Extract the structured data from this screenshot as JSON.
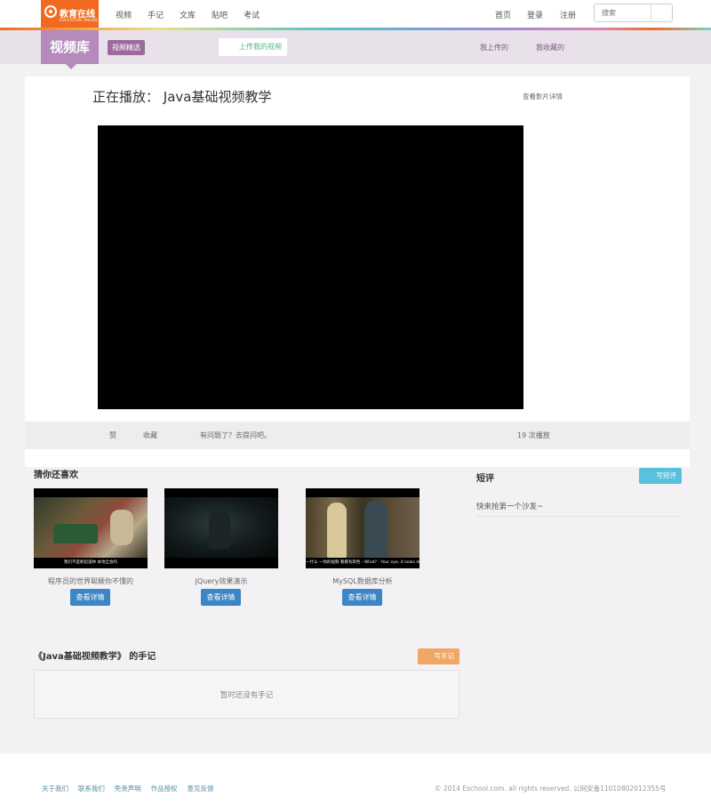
{
  "brand": {
    "name": "教育在线",
    "tagline": "EDUCATION ONLINE"
  },
  "topnav": {
    "left_items": [
      "视频",
      "手记",
      "文库",
      "贴吧",
      "考试"
    ],
    "right_items": [
      "首页",
      "登录",
      "注册"
    ],
    "search_placeholder": "搜索"
  },
  "subheader": {
    "library_label": "视频库",
    "featured_label": "视频精选",
    "upload_label": "上传我的视频",
    "my_uploads_label": "我上传的",
    "my_favorites_label": "我收藏的"
  },
  "player": {
    "now_playing_prefix": "正在播放：",
    "video_title": "Java基础视频教学",
    "detail_link": "查看影片详情",
    "like_label": "赞",
    "favorite_label": "收藏",
    "question_label": "有问题了？去提问吧。",
    "play_count": "19 次播放"
  },
  "recommendations": {
    "title": "猜你还喜欢",
    "items": [
      {
        "title": "程序员的世界聪颖你不懂的",
        "subtitle": "我们不是抓起道林 本地全会吗",
        "button": "查看详情"
      },
      {
        "title": "JQuery效果演示",
        "subtitle": "",
        "button": "查看详情"
      },
      {
        "title": "MySQL数据库分析",
        "subtitle": "一什么 一你的视频 看看有新色 - What? - Your eye, it looks dreamed",
        "button": "查看详情"
      }
    ]
  },
  "reviews": {
    "title": "短评",
    "write_button": "写短评",
    "empty_text": "快来抢第一个沙发~"
  },
  "notes": {
    "title": "《Java基础视频教学》 的手记",
    "write_button": "写手记",
    "empty_text": "暂时还没有手记"
  },
  "footer": {
    "links": [
      "关于我们",
      "联系我们",
      "免责声明",
      "作品授权",
      "意见反馈"
    ],
    "copyright": "© 2014 Eschool.com. all rights reserved. 公网安备11010802012355号"
  },
  "colors": {
    "brand_orange": "#f26a20",
    "library_purple": "#b48bbb",
    "detail_blue": "#3b86c6",
    "review_cyan": "#5bc0de",
    "note_orange": "#f0a766"
  }
}
